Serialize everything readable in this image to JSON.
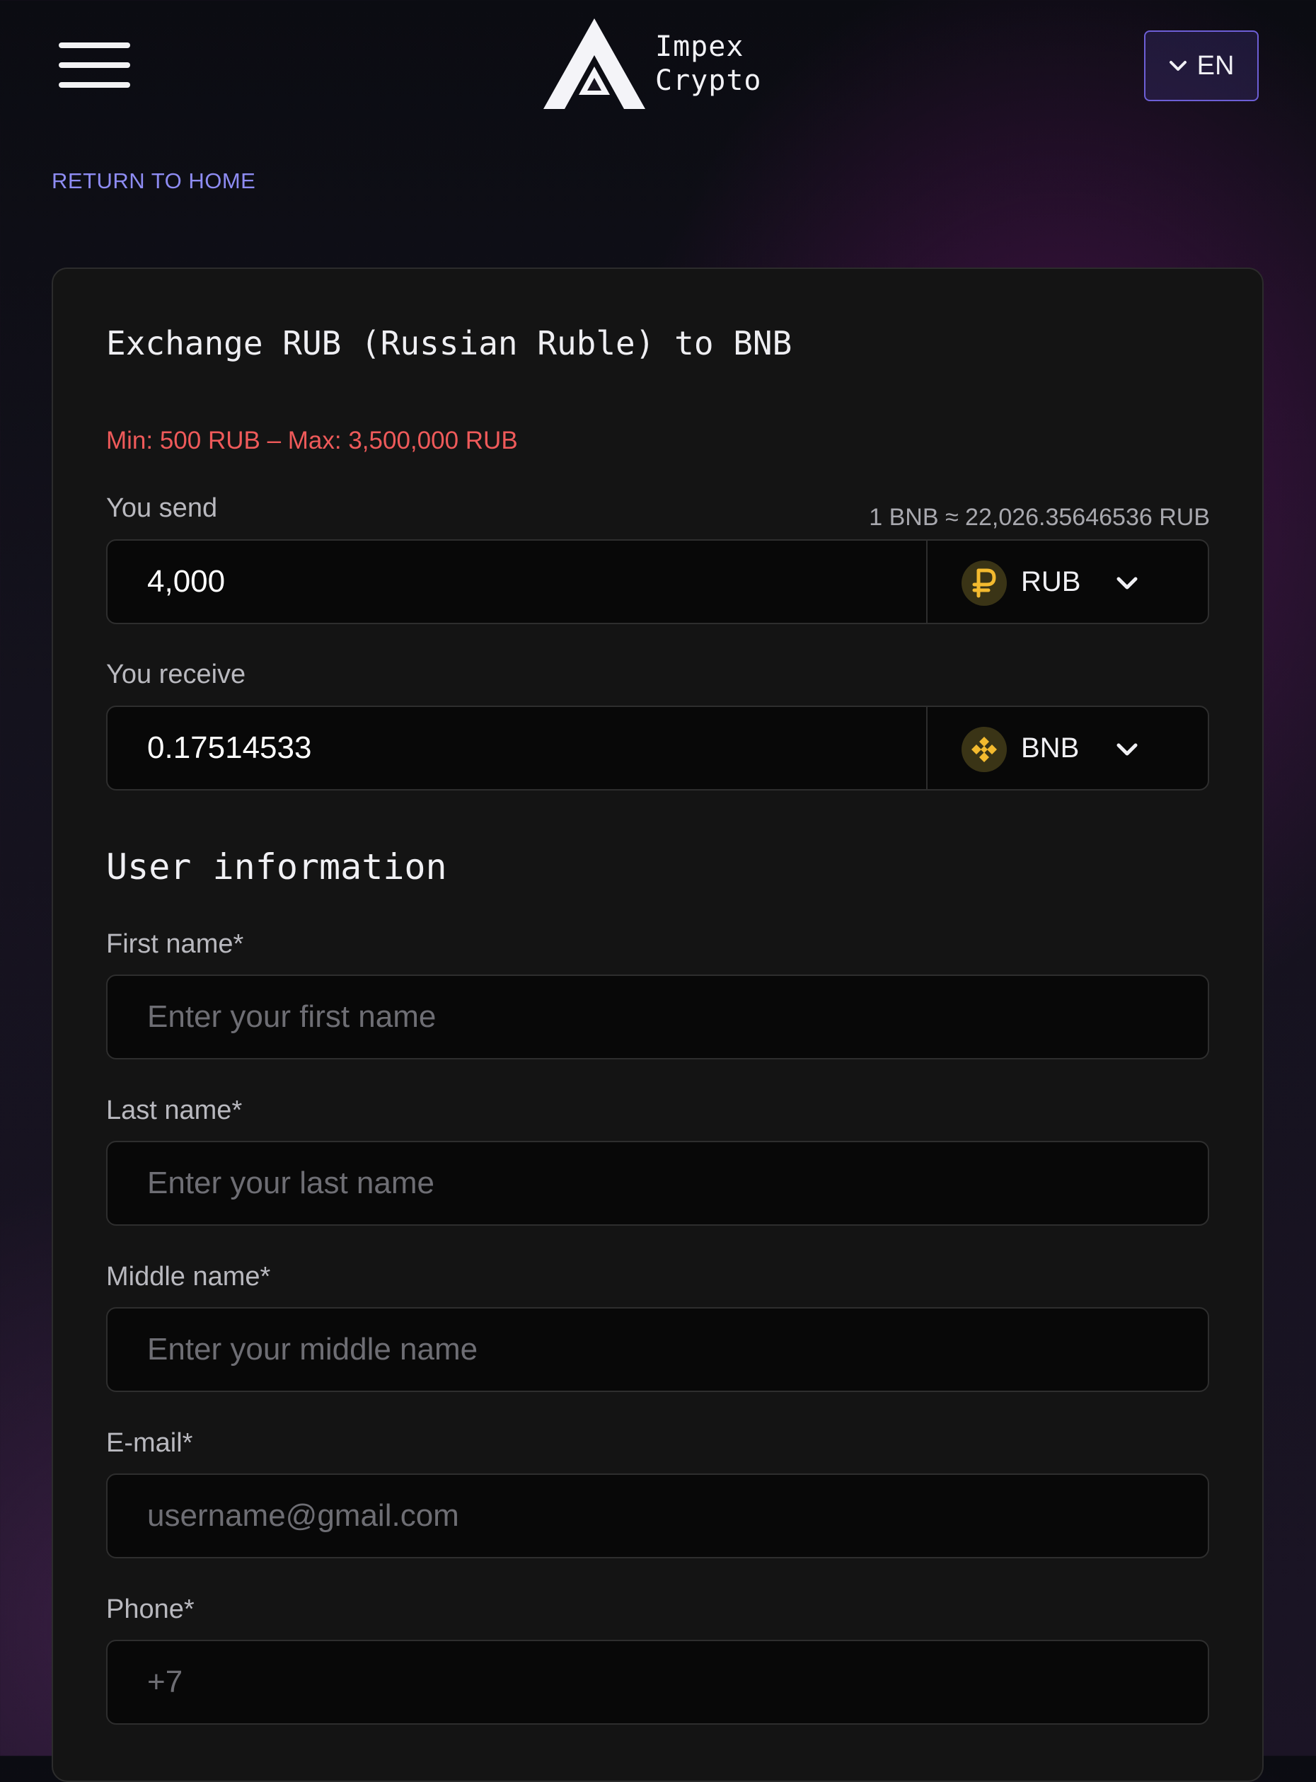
{
  "header": {
    "logo_line1": "Impex",
    "logo_line2": "Crypto",
    "language": "EN"
  },
  "nav": {
    "return_home": "RETURN TO HOME"
  },
  "exchange": {
    "title": "Exchange RUB (Russian Ruble) to BNB",
    "limits": "Min: 500 RUB – Max: 3,500,000 RUB",
    "send_label": "You send",
    "rate": "1 BNB ≈ 22,026.35646536 RUB",
    "send_value": "4,000",
    "send_currency": "RUB",
    "send_icon": "ruble-coin-icon",
    "receive_label": "You receive",
    "receive_value": "0.17514533",
    "receive_currency": "BNB",
    "receive_icon": "bnb-coin-icon"
  },
  "user_info": {
    "title": "User information",
    "first_name_label": "First name*",
    "first_name_placeholder": "Enter your first name",
    "last_name_label": "Last name*",
    "last_name_placeholder": "Enter your last name",
    "middle_name_label": "Middle name*",
    "middle_name_placeholder": "Enter your middle name",
    "email_label": "E-mail*",
    "email_placeholder": "username@gmail.com",
    "phone_label": "Phone*",
    "phone_placeholder": "+7"
  },
  "colors": {
    "accent": "#8e8cf3",
    "error": "#ef5a5a",
    "coin": "#f3ba2f"
  }
}
